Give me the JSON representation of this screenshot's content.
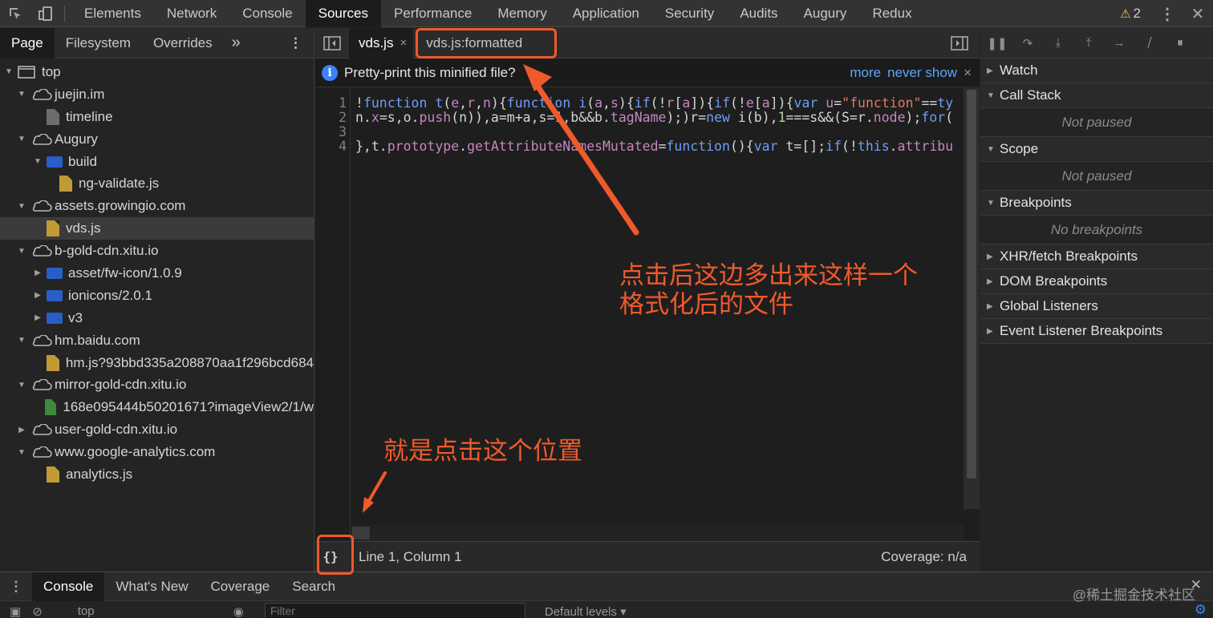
{
  "top_tabs": [
    "Elements",
    "Network",
    "Console",
    "Sources",
    "Performance",
    "Memory",
    "Application",
    "Security",
    "Audits",
    "Augury",
    "Redux"
  ],
  "active_top_tab": "Sources",
  "warnings_count": "2",
  "navigator": {
    "tabs": [
      "Page",
      "Filesystem",
      "Overrides"
    ],
    "more": "»",
    "tree": [
      {
        "label": "top",
        "indent": 0,
        "caret": "▼",
        "icon": "window"
      },
      {
        "label": "juejin.im",
        "indent": 1,
        "caret": "▼",
        "icon": "cloud"
      },
      {
        "label": "timeline",
        "indent": 2,
        "caret": "",
        "icon": "file-gray"
      },
      {
        "label": "Augury",
        "indent": 1,
        "caret": "▼",
        "icon": "cloud"
      },
      {
        "label": "build",
        "indent": 2,
        "caret": "▼",
        "icon": "folder"
      },
      {
        "label": "ng-validate.js",
        "indent": 3,
        "caret": "",
        "icon": "file-yellow"
      },
      {
        "label": "assets.growingio.com",
        "indent": 1,
        "caret": "▼",
        "icon": "cloud"
      },
      {
        "label": "vds.js",
        "indent": 2,
        "caret": "",
        "icon": "file-yellow",
        "selected": true
      },
      {
        "label": "b-gold-cdn.xitu.io",
        "indent": 1,
        "caret": "▼",
        "icon": "cloud"
      },
      {
        "label": "asset/fw-icon/1.0.9",
        "indent": 2,
        "caret": "▶",
        "icon": "folder"
      },
      {
        "label": "ionicons/2.0.1",
        "indent": 2,
        "caret": "▶",
        "icon": "folder"
      },
      {
        "label": "v3",
        "indent": 2,
        "caret": "▶",
        "icon": "folder"
      },
      {
        "label": "hm.baidu.com",
        "indent": 1,
        "caret": "▼",
        "icon": "cloud"
      },
      {
        "label": "hm.js?93bbd335a208870aa1f296bcd684",
        "indent": 2,
        "caret": "",
        "icon": "file-yellow"
      },
      {
        "label": "mirror-gold-cdn.xitu.io",
        "indent": 1,
        "caret": "▼",
        "icon": "cloud"
      },
      {
        "label": "168e095444b50201671?imageView2/1/w",
        "indent": 2,
        "caret": "",
        "icon": "file-green"
      },
      {
        "label": "user-gold-cdn.xitu.io",
        "indent": 1,
        "caret": "▶",
        "icon": "cloud"
      },
      {
        "label": "www.google-analytics.com",
        "indent": 1,
        "caret": "▼",
        "icon": "cloud"
      },
      {
        "label": "analytics.js",
        "indent": 2,
        "caret": "",
        "icon": "file-yellow"
      }
    ]
  },
  "editor": {
    "tabs": [
      "vds.js",
      "vds.js:formatted"
    ],
    "active_tab": "vds.js",
    "close_glyph": "×",
    "infobar": {
      "text": "Pretty-print this minified file?",
      "link1": "more",
      "link2": "never show",
      "close": "×"
    },
    "line_numbers": [
      "1",
      "2",
      "3",
      "4"
    ],
    "status": {
      "position": "Line 1, Column 1",
      "coverage": "Coverage: n/a",
      "pretty_icon": "{}"
    }
  },
  "debugger": {
    "sections": [
      {
        "title": "Watch",
        "expanded": false
      },
      {
        "title": "Call Stack",
        "expanded": true,
        "body": "Not paused"
      },
      {
        "title": "Scope",
        "expanded": true,
        "body": "Not paused"
      },
      {
        "title": "Breakpoints",
        "expanded": true,
        "body": "No breakpoints"
      },
      {
        "title": "XHR/fetch Breakpoints",
        "expanded": false
      },
      {
        "title": "DOM Breakpoints",
        "expanded": false
      },
      {
        "title": "Global Listeners",
        "expanded": false
      },
      {
        "title": "Event Listener Breakpoints",
        "expanded": false
      }
    ]
  },
  "drawer": {
    "tabs": [
      "Console",
      "What's New",
      "Coverage",
      "Search"
    ],
    "active_tab": "Console",
    "context": "top",
    "filter_placeholder": "Filter",
    "levels": "Default levels ▾",
    "watermark": "@稀土掘金技术社区"
  },
  "annotations": {
    "note1_line1": "点击后这边多出来这样一个",
    "note1_line2": "格式化后的文件",
    "note2": "就是点击这个位置"
  },
  "colors": {
    "accent": "#ef5a2a",
    "link": "#5ea5ff",
    "folder": "#2a5ec7"
  }
}
